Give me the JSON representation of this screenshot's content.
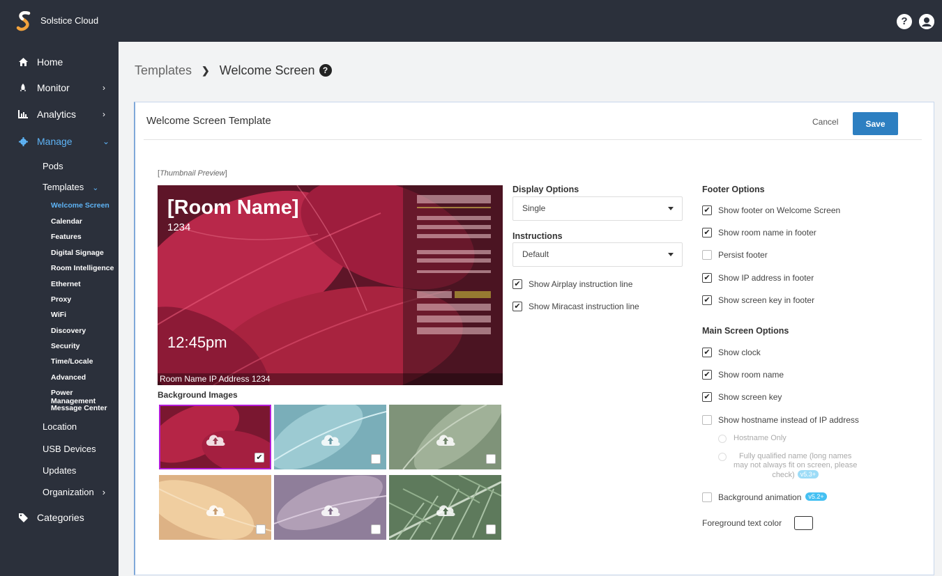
{
  "app": {
    "title": "Solstice Cloud"
  },
  "icons": {
    "logo": "solstice-logo-icon",
    "help": "question-icon",
    "account": "user-circle-icon"
  },
  "sidebar": {
    "main": [
      {
        "label": "Home",
        "icon": "home-icon"
      },
      {
        "label": "Monitor",
        "icon": "rocket-icon"
      },
      {
        "label": "Analytics",
        "icon": "bar-chart-icon"
      },
      {
        "label": "Manage",
        "icon": "gear-icon"
      }
    ],
    "manage_sub": [
      "Pods",
      "Templates",
      "Location",
      "USB Devices",
      "Updates",
      "Organization"
    ],
    "templates_sub": [
      "Welcome Screen",
      "Calendar",
      "Features",
      "Digital Signage",
      "Room Intelligence",
      "Ethernet",
      "Proxy",
      "WiFi",
      "Discovery",
      "Security",
      "Time/Locale",
      "Advanced",
      "Power Management",
      "Message Center"
    ],
    "categories": {
      "label": "Categories",
      "icon": "tag-icon"
    }
  },
  "breadcrumb": {
    "parent": "Templates",
    "current": "Welcome Screen"
  },
  "card": {
    "title": "Welcome Screen Template",
    "cancel": "Cancel",
    "save": "Save"
  },
  "preview": {
    "label": "Thumbnail Preview",
    "room_name": "[Room Name]",
    "screen_key": "1234",
    "time": "12:45pm",
    "footer": "Room Name IP Address 1234"
  },
  "background_images": {
    "label": "Background Images",
    "tiles": [
      {
        "name": "red-leaves",
        "selected": true,
        "color": "#a8203f"
      },
      {
        "name": "teal-leaves",
        "selected": false,
        "color": "#7fb6c2"
      },
      {
        "name": "green-leaves",
        "selected": false,
        "color": "#8ea086"
      },
      {
        "name": "peach-leaves",
        "selected": false,
        "color": "#e3b98b"
      },
      {
        "name": "purple-leaves",
        "selected": false,
        "color": "#a38fa6"
      },
      {
        "name": "palm-fronds",
        "selected": false,
        "color": "#6f8b6a"
      }
    ]
  },
  "display_options": {
    "label": "Display Options",
    "value": "Single"
  },
  "instructions": {
    "label": "Instructions",
    "value": "Default",
    "airplay": "Show Airplay instruction line",
    "miracast": "Show Miracast instruction line"
  },
  "footer_options": {
    "label": "Footer Options",
    "items": [
      {
        "label": "Show footer on Welcome Screen",
        "checked": true
      },
      {
        "label": "Show room name in footer",
        "checked": true
      },
      {
        "label": "Persist footer",
        "checked": false
      },
      {
        "label": "Show IP address in footer",
        "checked": true
      },
      {
        "label": "Show screen key in footer",
        "checked": true
      }
    ]
  },
  "main_screen_options": {
    "label": "Main Screen Options",
    "show_clock": "Show clock",
    "show_room_name": "Show room name",
    "show_screen_key": "Show screen key",
    "show_hostname": "Show hostname instead of IP address",
    "hostname_only": "Hostname Only",
    "fqdn_lines": [
      "Fully qualified name (long names",
      "may not always fit on screen, please",
      "check)"
    ],
    "fqdn_badge": "v5.3+",
    "bg_animation": "Background animation",
    "bg_animation_badge": "v5.2+",
    "fg_color": "Foreground text color"
  },
  "colors": {
    "accent": "#5eb3f5",
    "save": "#2d7fc1",
    "selected_tile": "#b31bd9",
    "nav_bg": "#2b303b"
  }
}
